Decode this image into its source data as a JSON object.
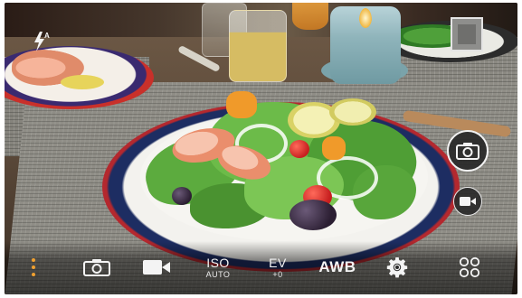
{
  "camera": {
    "flash": {
      "icon": "flash-auto-icon"
    },
    "gallery_thumbnail": {
      "icon": "last-photo-thumbnail"
    },
    "shutter_button": {
      "icon": "camera-shutter-icon"
    },
    "record_button": {
      "icon": "video-record-icon"
    }
  },
  "bottom_bar": {
    "more": {
      "icon": "dots-vertical-icon",
      "color": "#f0a030"
    },
    "photo_mode": {
      "icon": "camera-mode-icon"
    },
    "video_mode": {
      "icon": "video-mode-icon"
    },
    "iso": {
      "label": "ISO",
      "value": "AUTO"
    },
    "ev": {
      "label": "EV",
      "value": "+0"
    },
    "white_balance": {
      "label": "AWB"
    },
    "settings": {
      "icon": "gear-icon"
    },
    "modes": {
      "icon": "grid-circles-icon"
    }
  },
  "colors": {
    "overlay_white": "#f4f4f4",
    "accent_orange": "#f0a030"
  }
}
